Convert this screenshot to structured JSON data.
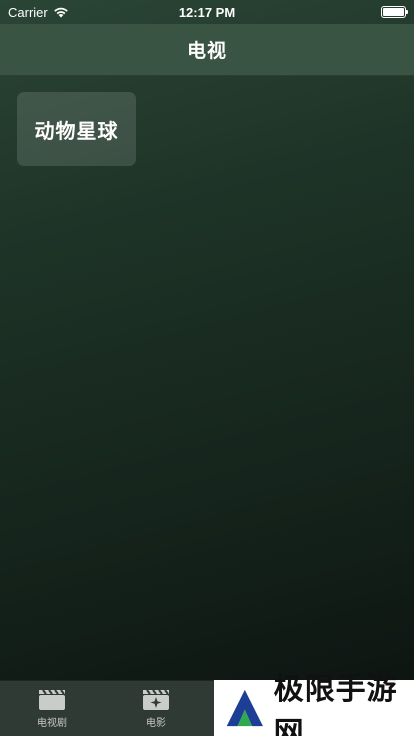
{
  "status_bar": {
    "carrier": "Carrier",
    "time": "12:17 PM",
    "battery_level": 1.0
  },
  "nav": {
    "title": "电视"
  },
  "channels": [
    {
      "label": "动物星球"
    }
  ],
  "tabs": [
    {
      "label": "电视剧",
      "icon": "clapperboard-icon"
    },
    {
      "label": "电影",
      "icon": "movie-sparkle-icon"
    }
  ],
  "watermark": {
    "text": "极限手游网",
    "icon": "logo-icon"
  },
  "colors": {
    "nav_bar": "#3a5444",
    "background_top": "#2a4535",
    "background_bottom": "#0c120f",
    "tab_bar": "#303a34",
    "logo_blue": "#1c3f95",
    "logo_green": "#2fa84f"
  }
}
